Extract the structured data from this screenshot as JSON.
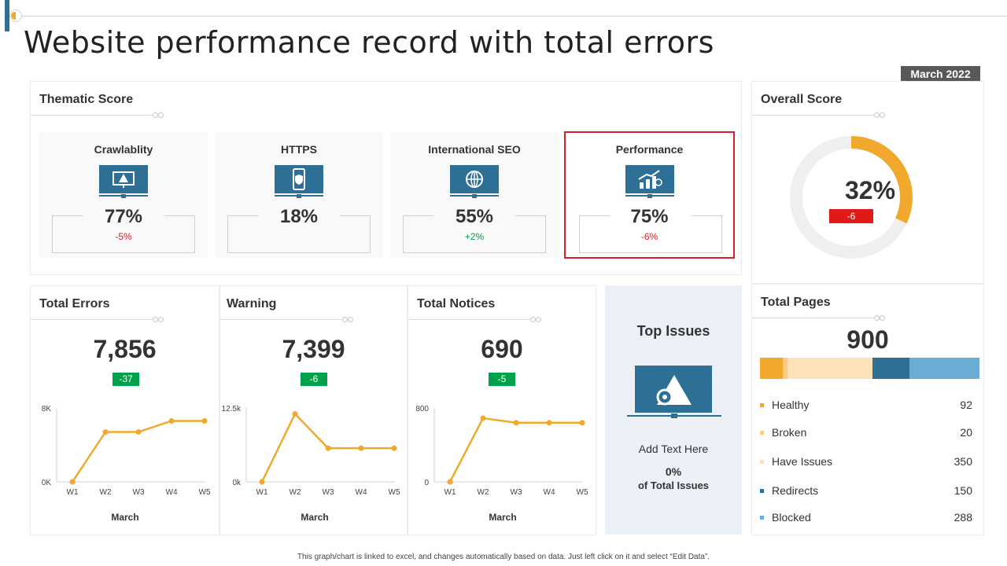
{
  "page": {
    "title": "Website performance record with total errors",
    "date_badge": "March 2022"
  },
  "thematic": {
    "title": "Thematic Score",
    "cards": [
      {
        "name": "Crawlablity",
        "value": "77%",
        "delta": "-5%",
        "delta_color": "#d61f26",
        "icon": "warning-monitor-icon"
      },
      {
        "name": "HTTPS",
        "value": "18%",
        "delta": "",
        "delta_color": "#d61f26",
        "icon": "secure-phone-icon"
      },
      {
        "name": "International SEO",
        "value": "55%",
        "delta": "+2%",
        "delta_color": "#00a14b",
        "icon": "globe-network-icon"
      },
      {
        "name": "Performance",
        "value": "75%",
        "delta": "-6%",
        "delta_color": "#d61f26",
        "icon": "growth-chart-icon"
      }
    ]
  },
  "overall": {
    "title": "Overall Score",
    "value": "32%",
    "percent": 32,
    "delta": "-6"
  },
  "metrics": [
    {
      "title": "Total Errors",
      "value": "7,856",
      "delta": "-37",
      "xlabel": "March",
      "chart_data": {
        "type": "line",
        "categories": [
          "W1",
          "W2",
          "W3",
          "W4",
          "W5"
        ],
        "values": [
          0,
          5400,
          5400,
          6600,
          6600
        ],
        "ylim": [
          0,
          8000
        ],
        "tick_labels": [
          "0K",
          "8K"
        ],
        "xlabel": "March"
      }
    },
    {
      "title": "Warning",
      "value": "7,399",
      "delta": "-6",
      "xlabel": "March",
      "chart_data": {
        "type": "line",
        "categories": [
          "W1",
          "W2",
          "W3",
          "W4",
          "W5"
        ],
        "values": [
          0,
          11500,
          5700,
          5700,
          5700
        ],
        "ylim": [
          0,
          12500
        ],
        "tick_labels": [
          "0k",
          "12.5k"
        ],
        "xlabel": "March"
      }
    },
    {
      "title": "Total Notices",
      "value": "690",
      "delta": "-5",
      "xlabel": "March",
      "chart_data": {
        "type": "line",
        "categories": [
          "W1",
          "W2",
          "W3",
          "W4",
          "W5"
        ],
        "values": [
          0,
          690,
          640,
          640,
          640
        ],
        "ylim": [
          0,
          800
        ],
        "tick_labels": [
          "0",
          "800"
        ],
        "xlabel": "March"
      }
    }
  ],
  "top_issues": {
    "title": "Top Issues",
    "add_text": "Add Text Here",
    "percent": "0%",
    "sub": "of Total Issues"
  },
  "pages": {
    "title": "Total Pages",
    "total": "900",
    "items": [
      {
        "label": "Healthy",
        "value": "92",
        "amount": 92,
        "color": "#f0a92d"
      },
      {
        "label": "Broken",
        "value": "20",
        "amount": 20,
        "color": "#f8cb86"
      },
      {
        "label": "Have Issues",
        "value": "350",
        "amount": 350,
        "color": "#fbe2b9"
      },
      {
        "label": "Redirects",
        "value": "150",
        "amount": 150,
        "color": "#2e6f95"
      },
      {
        "label": "Blocked",
        "value": "288",
        "amount": 288,
        "color": "#6aadd5"
      }
    ]
  },
  "footnote": "This graph/chart is linked to excel, and changes automatically based on data. Just left click on it and select “Edit Data”.",
  "colors": {
    "accent_orange": "#f0a92d",
    "dark_blue": "#2e6f95",
    "negative": "#e11919",
    "positive": "#00a14b"
  }
}
